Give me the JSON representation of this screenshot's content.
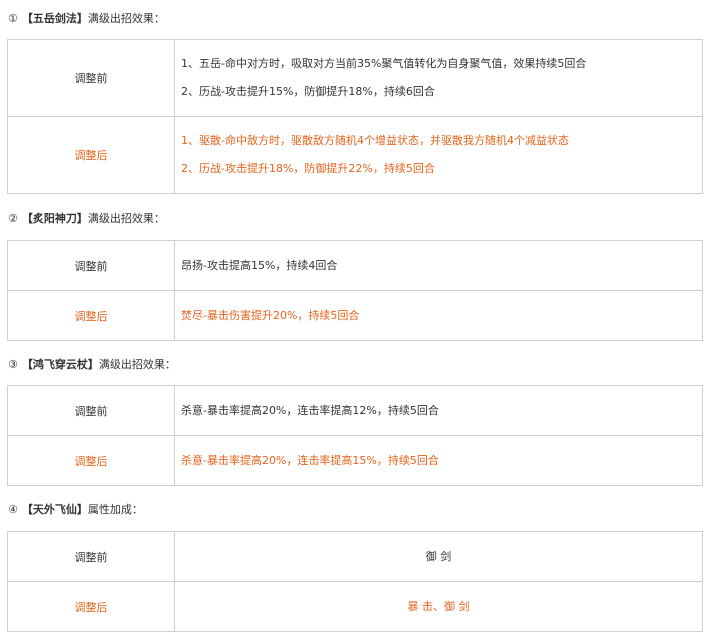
{
  "sections": [
    {
      "num": "①",
      "name": "【五岳剑法】",
      "suffix": "满级出招效果：",
      "before_label": "调整前",
      "after_label": "调整后",
      "before": [
        "1、五岳-命中对方时，吸取对方当前35%聚气值转化为自身聚气值，效果持续5回合",
        "2、历战-攻击提升15%，防御提升18%，持续6回合"
      ],
      "after": [
        "1、驱散-命中敌方时，驱散敌方随机4个增益状态，并驱散我方随机4个减益状态",
        "2、历战-攻击提升18%，防御提升22%，持续5回合"
      ]
    },
    {
      "num": "②",
      "name": "【炙阳神刀】",
      "suffix": "满级出招效果：",
      "before_label": "调整前",
      "after_label": "调整后",
      "before": [
        "昂扬-攻击提高15%，持续4回合"
      ],
      "after": [
        "焚尽-暴击伤害提升20%，持续5回合"
      ]
    },
    {
      "num": "③",
      "name": "【鸿飞穿云杖】",
      "suffix": "满级出招效果：",
      "before_label": "调整前",
      "after_label": "调整后",
      "before": [
        "杀意-暴击率提高20%，连击率提高12%，持续5回合"
      ],
      "after": [
        "杀意-暴击率提高20%，连击率提高15%，持续5回合"
      ]
    },
    {
      "num": "④",
      "name": "【天外飞仙】",
      "suffix": "属性加成：",
      "before_label": "调整前",
      "after_label": "调整后",
      "before": [
        "御 剑"
      ],
      "after": [
        "暴 击、御 剑"
      ]
    }
  ],
  "colors": {
    "highlight": "#e4641c",
    "text": "#333333",
    "border": "#cfcfcf"
  }
}
